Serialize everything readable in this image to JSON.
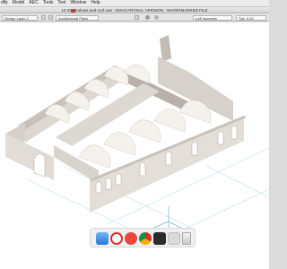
{
  "menubar": {
    "items": [
      "dify",
      "Model",
      "AEC",
      "Tools",
      "Text",
      "Window",
      "Help"
    ]
  },
  "window": {
    "title": "10-20 windows and roof.vwx : EDUCATIONAL VERSION - WATERMARKED FILE"
  },
  "viewbar": {
    "class_field": "Design Layer-1",
    "layer_field": "Architectural Plans",
    "view_field": "Left Isometric",
    "zoom_field": "Tpk: 0.00"
  },
  "colors": {
    "viewport_background": "#ffffff",
    "wall_stone": "#dcd6d1",
    "wall_stone_shadow": "#c9c2bc",
    "vault_shell": "#f5f2ee",
    "grid_line": "#bfe2ec",
    "ground_axis": "#7fb4e6"
  },
  "dock": {
    "icons": [
      "finder-icon",
      "opera-icon",
      "vivaldi-icon",
      "chrome-icon",
      "vectorworks-icon",
      "app-icon",
      "trash-icon"
    ]
  }
}
